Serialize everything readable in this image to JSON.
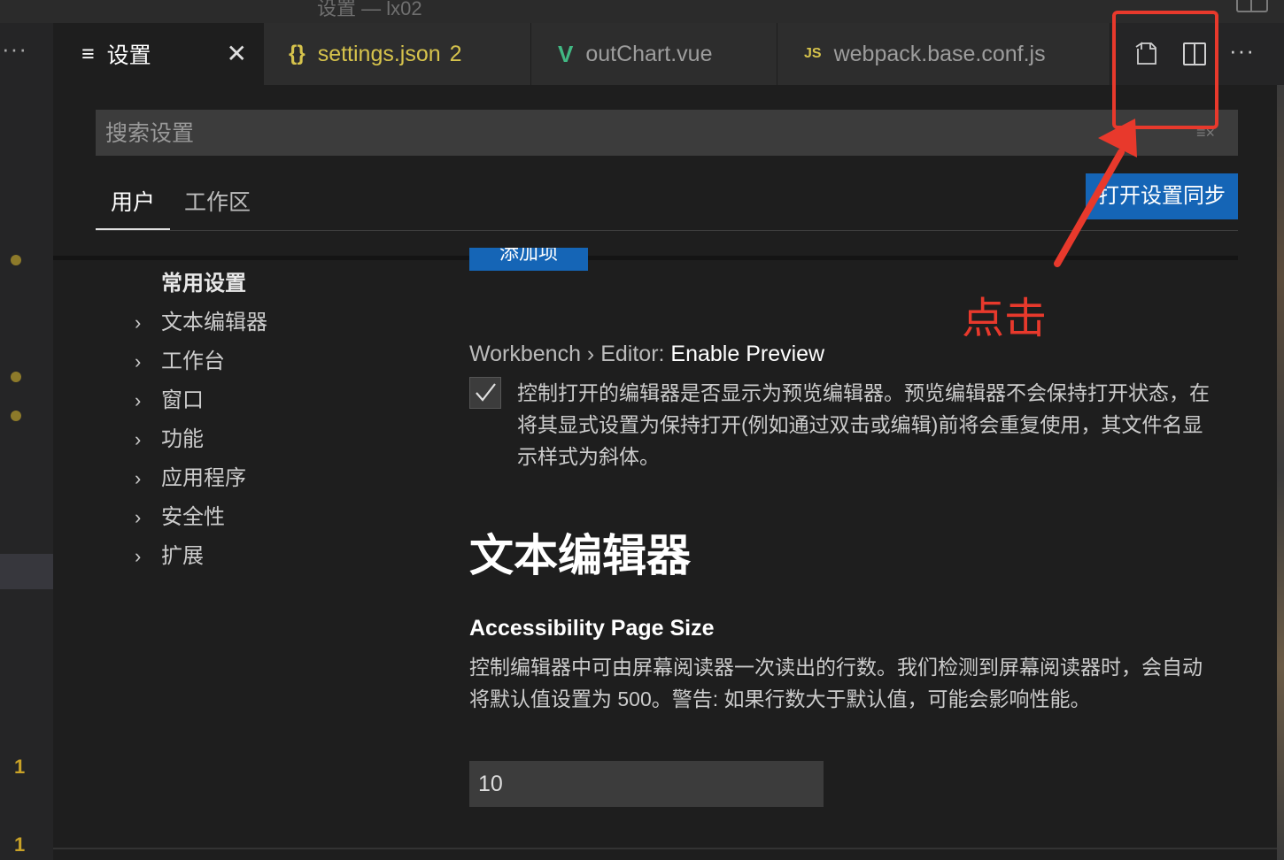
{
  "window": {
    "title": "设置 — lx02"
  },
  "gutter": {
    "more": "···",
    "line_numbers": [
      "1",
      "1"
    ]
  },
  "tabs": {
    "settings": {
      "icon": "≡",
      "label": "设置",
      "close": "✕"
    },
    "settings_json": {
      "icon": "{}",
      "label": "settings.json",
      "badge": "2"
    },
    "outchart": {
      "icon": "V",
      "label": "outChart.vue"
    },
    "webpack": {
      "icon": "JS",
      "label": "webpack.base.conf.js"
    }
  },
  "editor_actions": {
    "open_json_icon": "open-settings-json-icon",
    "split_icon": "split-editor-icon",
    "more": "···"
  },
  "search": {
    "placeholder": "搜索设置",
    "clear_icon": "≡×"
  },
  "scope_tabs": {
    "user": "用户",
    "workspace": "工作区"
  },
  "sync_button": {
    "label": "打开设置同步"
  },
  "toc": {
    "common": "常用设置",
    "items": [
      "文本编辑器",
      "工作台",
      "窗口",
      "功能",
      "应用程序",
      "安全性",
      "扩展"
    ],
    "chevron": "›"
  },
  "content": {
    "add_item_label": "添加项",
    "preview_setting": {
      "category": "Workbench › Editor: ",
      "name": "Enable Preview",
      "checked": true,
      "description": "控制打开的编辑器是否显示为预览编辑器。预览编辑器不会保持打开状态，在将其显式设置为保持打开(例如通过双击或编辑)前将会重复使用，其文件名显示样式为斜体。"
    },
    "section_heading": "文本编辑器",
    "page_size_setting": {
      "title": "Accessibility Page Size",
      "description": "控制编辑器中可由屏幕阅读器一次读出的行数。我们检测到屏幕阅读器时，会自动将默认值设置为 500。警告: 如果行数大于默认值，可能会影响性能。",
      "value": "10"
    }
  },
  "annotation": {
    "label": "点击",
    "color": "#e8392c"
  },
  "colors": {
    "accent": "#1565b6",
    "background": "#1e1e1e",
    "warning_dot": "#8d7a2a"
  }
}
